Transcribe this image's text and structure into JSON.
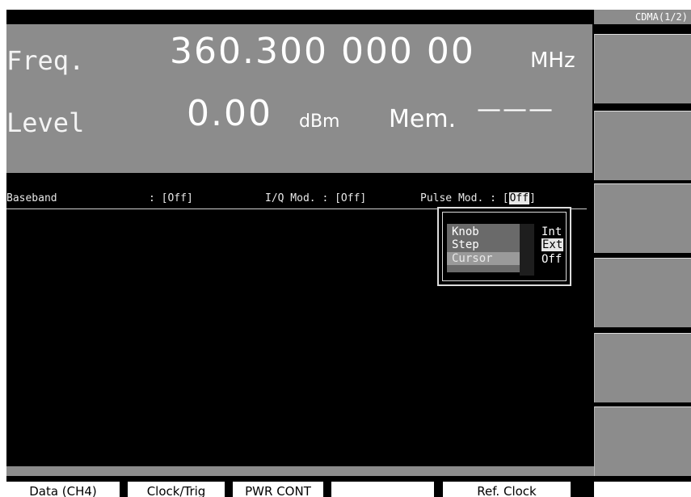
{
  "header": {
    "freq_label": "Freq.",
    "freq_value": "360.300 000 00",
    "freq_unit": "MHz",
    "level_label": "Level",
    "level_value": "0.00",
    "level_unit": "dBm",
    "mem_label": "Mem.",
    "mem_value": "———"
  },
  "status": {
    "baseband_label": "Baseband",
    "baseband_value": ": [Off]",
    "iq_text": "I/Q Mod. : [Off]",
    "pulse_label": "Pulse Mod. : [",
    "pulse_value": "Off",
    "pulse_close": "]"
  },
  "popup": {
    "left_options": [
      "Knob",
      "Step",
      "Cursor"
    ],
    "right_options": [
      "Int",
      "Ext",
      "Off"
    ],
    "selected_right": "Ext"
  },
  "softkeys": {
    "title": "CDMA(1/2)",
    "keys": [
      "",
      "",
      "",
      "",
      "",
      ""
    ]
  },
  "tabs": [
    "Data (CH4)",
    "Clock/Trig",
    "PWR CONT",
    "",
    "Ref. Clock"
  ],
  "colors": {
    "panel_gray": "#8c8c8c",
    "screen_black": "#000000",
    "highlight_white": "#e6e6e6"
  }
}
